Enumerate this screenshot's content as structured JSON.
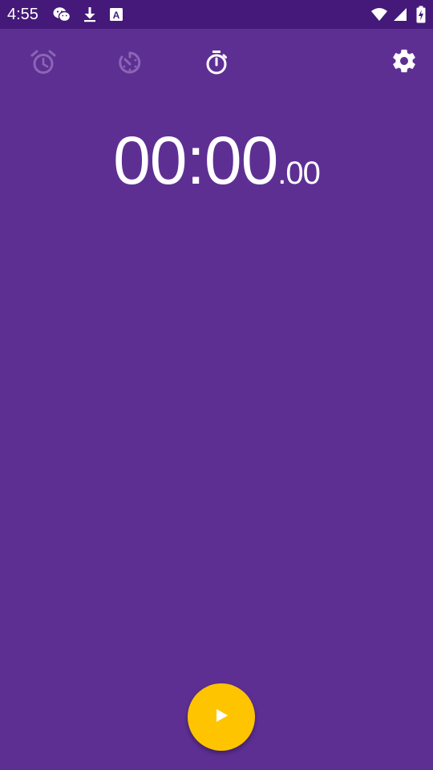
{
  "status_bar": {
    "time": "4:55",
    "icons": [
      "wechat-icon",
      "download-icon",
      "keyboard-a-icon",
      "wifi-icon",
      "cell-signal-icon",
      "battery-charging-icon"
    ]
  },
  "tabs": [
    {
      "name": "alarm",
      "icon": "alarm-icon",
      "active": false
    },
    {
      "name": "timer",
      "icon": "timer-icon",
      "active": false
    },
    {
      "name": "stopwatch",
      "icon": "stopwatch-icon",
      "active": true
    }
  ],
  "settings": {
    "icon": "gear-icon"
  },
  "stopwatch": {
    "main": "00:00",
    "hundredths": ".00"
  },
  "fab": {
    "icon": "play-icon"
  },
  "colors": {
    "background": "#5E2F93",
    "status_bar": "#44197A",
    "accent": "#FFC400",
    "inactive_icon": "#8A66B5"
  }
}
